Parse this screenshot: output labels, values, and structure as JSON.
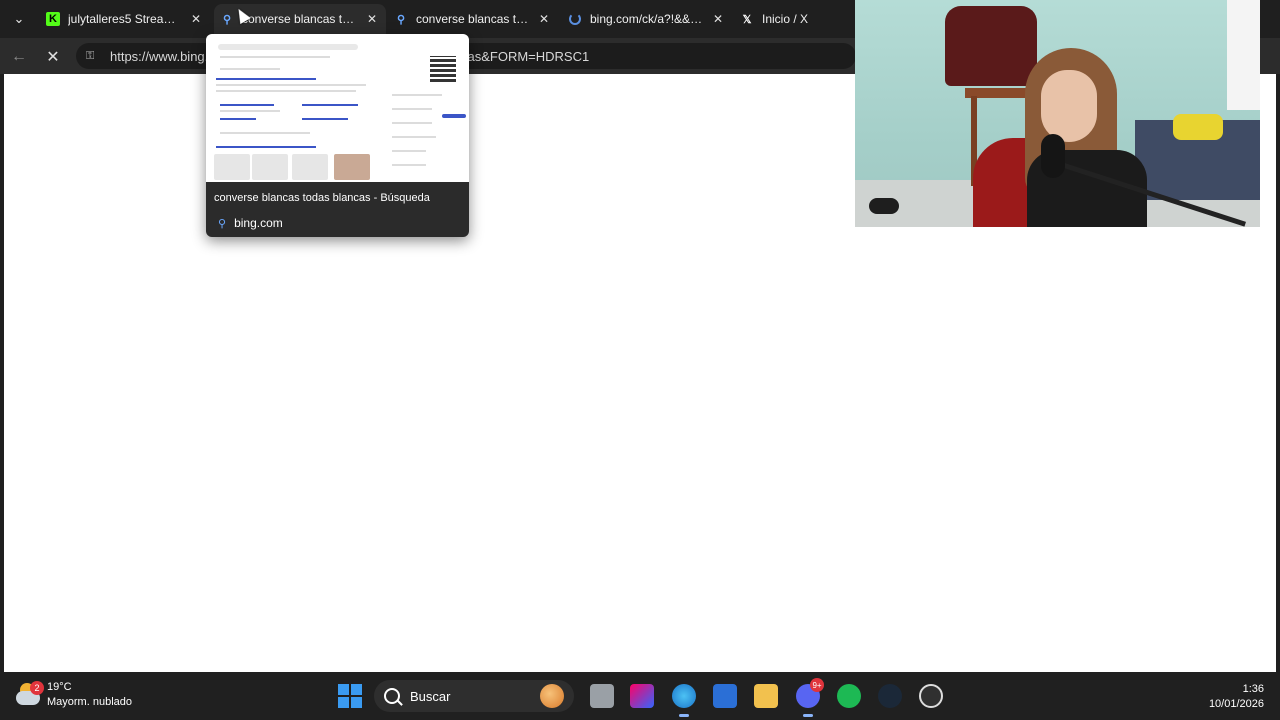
{
  "browser": {
    "tabs": [
      {
        "title": "julytalleres5 Stream - W",
        "favicon": "kick-icon",
        "active": false
      },
      {
        "title": "converse blancas todas",
        "favicon": "bing-search-icon",
        "active": true
      },
      {
        "title": "converse blancas todas",
        "favicon": "bing-search-icon",
        "active": false
      },
      {
        "title": "bing.com/ck/a?!&&p=6",
        "favicon": "loading-spinner-icon",
        "active": false
      },
      {
        "title": "Inicio / X",
        "favicon": "x-logo-icon",
        "active": false
      }
    ],
    "address": {
      "url_start": "https://www.bing.",
      "url_end": "cas&FORM=HDRSC1"
    },
    "preview": {
      "title": "converse blancas todas blancas - Búsqueda",
      "domain": "bing.com"
    }
  },
  "taskbar": {
    "weather": {
      "badge": "2",
      "temp": "19°C",
      "condition": "Mayorm. nublado"
    },
    "search_label": "Buscar",
    "discord_badge": "9+",
    "time": "1:36",
    "date": "10/01/2026"
  }
}
